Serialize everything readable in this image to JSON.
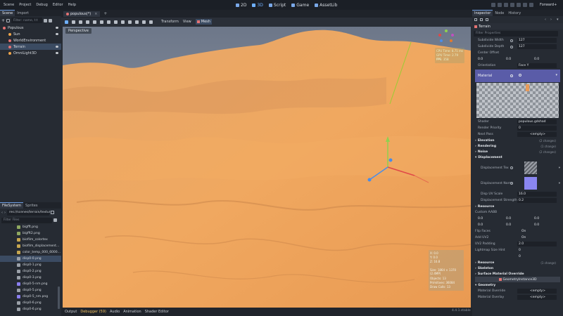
{
  "menu": [
    "Scene",
    "Project",
    "Debug",
    "Editor",
    "Help"
  ],
  "workspaces": [
    {
      "label": "2D",
      "active": false
    },
    {
      "label": "3D",
      "active": true
    },
    {
      "label": "Script",
      "active": false
    },
    {
      "label": "Game",
      "active": false
    },
    {
      "label": "AssetLib",
      "active": false
    }
  ],
  "renderer": "Forward+",
  "left_tabs": {
    "scene": "Scene",
    "import": "Import"
  },
  "scene_filter_placeholder": "Filter: name, t:t",
  "tree": [
    {
      "label": "Populous",
      "color": "#e57373"
    },
    {
      "label": "Sun",
      "color": "#f0a64a"
    },
    {
      "label": "WorldEnvironment",
      "color": "#e57373"
    },
    {
      "label": "Terrain",
      "color": "#e57373"
    },
    {
      "label": "OmniLight3D",
      "color": "#f0a64a"
    }
  ],
  "fs_tabs": {
    "filesystem": "FileSystem",
    "sprites": "Sprites"
  },
  "fs_path": "res://scenes/terrain/textur",
  "fs_filter_placeholder": "Filter Files",
  "files": [
    {
      "label": "bigfft.png",
      "color": "#8fa860"
    },
    {
      "label": "bigfft2.png",
      "color": "#8fa860"
    },
    {
      "label": "biofilm_colortex",
      "color": "#c6a64f"
    },
    {
      "label": "biofilm_displacement...",
      "color": "#c6a64f"
    },
    {
      "label": "color_temp_000_6000...",
      "color": "#c6a64f"
    },
    {
      "label": "disp0-0.png",
      "color": "#9aa0a8"
    },
    {
      "label": "disp0-1.png",
      "color": "#9aa0a8"
    },
    {
      "label": "disp0-2.png",
      "color": "#9aa0a8"
    },
    {
      "label": "disp0-3.png",
      "color": "#9aa0a8"
    },
    {
      "label": "disp0-5-nm.png",
      "color": "#8a7ff0"
    },
    {
      "label": "disp0-5.png",
      "color": "#9aa0a8"
    },
    {
      "label": "disp0-5_nm.png",
      "color": "#8a7ff0"
    },
    {
      "label": "disp0-6.png",
      "color": "#9aa0a8"
    },
    {
      "label": "disp0-6.png",
      "color": "#9aa0a8"
    }
  ],
  "scene_tab": "populous(*)",
  "toolbar_menus": {
    "transform": "Transform",
    "view": "View",
    "mesh": "Mesh"
  },
  "viewport": {
    "perspective_label": "Perspective",
    "perf": [
      "CPU Time: 8.71 ms",
      "GPU Time: 2.79 ms",
      "FPS: 358"
    ],
    "stats": [
      "X: 0.0",
      "Y: 0.0",
      "Z: 16.8",
      "",
      "Size: 1864 × 1370 (2.4MP)",
      "",
      "Objects: 13",
      "Primitives: 36084",
      "Draw Calls: 13"
    ]
  },
  "bottom_tabs": [
    "Output",
    "Debugger (59)",
    "Audio",
    "Animation",
    "Shader Editor"
  ],
  "version": "4.4.1.stable",
  "inspector": {
    "tabs": {
      "inspector": "Inspector",
      "node": "Node",
      "history": "History"
    },
    "node_name": "Terrain",
    "filter_placeholder": "Filter Properties",
    "subdiv_width_label": "Subdivide Width",
    "subdiv_width": "127",
    "subdiv_depth_label": "Subdivide Depth",
    "subdiv_depth": "127",
    "center_offset_label": "Center Offset",
    "center_offset": [
      "0.0",
      "0.0",
      "0.0"
    ],
    "orientation_label": "Orientation",
    "orientation": "Face Y",
    "material_label": "Material",
    "shader_label": "Shader",
    "shader": "populous.gdshad",
    "render_priority_label": "Render Priority",
    "render_priority": "0",
    "next_pass_label": "Next Pass",
    "next_pass": "<empty>",
    "sections": [
      {
        "label": "Elevation",
        "changes": "(2 changes)"
      },
      {
        "label": "Rendering",
        "changes": "(1 change)"
      },
      {
        "label": "Noise",
        "changes": "(2 changes)"
      }
    ],
    "displacement_label": "Displacement",
    "disp_tex_label": "Displacement Tex",
    "disp_norm_label": "Displacement Norm",
    "disp_uv_label": "Disp UV Scale",
    "disp_uv": "16.0",
    "disp_strength_label": "Displacement Strength",
    "disp_strength": "0.2",
    "resource_label": "Resource",
    "custom_aabb_label": "Custom AABB",
    "aabb": [
      "0.0",
      "0.0",
      "0.0",
      "0.0",
      "0.0",
      "0.0"
    ],
    "flip_faces_label": "Flip Faces",
    "flip_faces": "On",
    "add_uv2_label": "Add UV2",
    "add_uv2": "On",
    "uv2_padding_label": "UV2 Padding",
    "uv2_padding": "2.0",
    "lightmap_label": "Lightmap Size Hint",
    "lightmap": [
      "0",
      "0"
    ],
    "resource2_label": "Resource",
    "resource2_changes": "(1 change)",
    "skeleton_label": "Skeleton",
    "surface_override_label": "Surface Material Override",
    "geometry_instance_label": "GeometryInstance3D",
    "geometry_label": "Geometry",
    "material_override_label": "Material Override",
    "material_override": "<empty>",
    "material_overlay_label": "Material Overlay",
    "material_overlay": "<empty>"
  }
}
